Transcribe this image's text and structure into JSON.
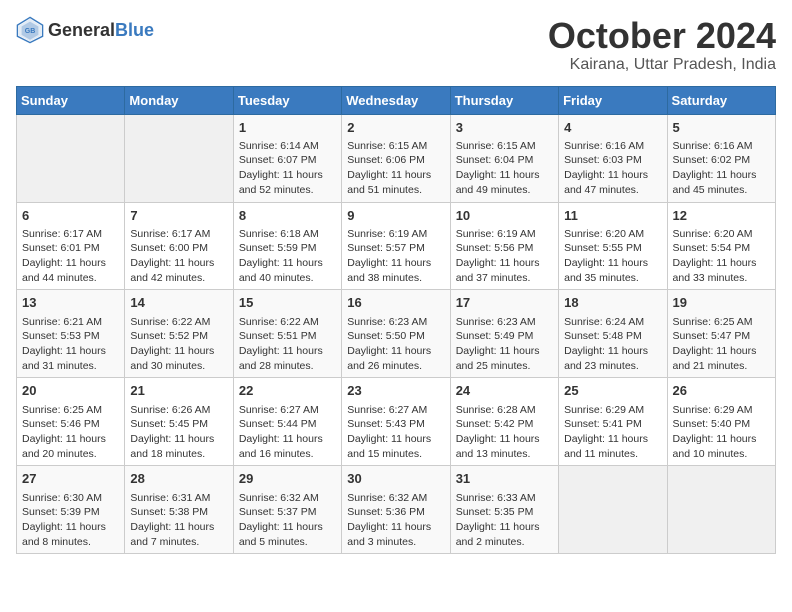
{
  "header": {
    "logo_general": "General",
    "logo_blue": "Blue",
    "title": "October 2024",
    "subtitle": "Kairana, Uttar Pradesh, India"
  },
  "columns": [
    "Sunday",
    "Monday",
    "Tuesday",
    "Wednesday",
    "Thursday",
    "Friday",
    "Saturday"
  ],
  "weeks": [
    [
      {
        "day": "",
        "sunrise": "",
        "sunset": "",
        "daylight": "",
        "empty": true
      },
      {
        "day": "",
        "sunrise": "",
        "sunset": "",
        "daylight": "",
        "empty": true
      },
      {
        "day": "1",
        "sunrise": "Sunrise: 6:14 AM",
        "sunset": "Sunset: 6:07 PM",
        "daylight": "Daylight: 11 hours and 52 minutes.",
        "empty": false
      },
      {
        "day": "2",
        "sunrise": "Sunrise: 6:15 AM",
        "sunset": "Sunset: 6:06 PM",
        "daylight": "Daylight: 11 hours and 51 minutes.",
        "empty": false
      },
      {
        "day": "3",
        "sunrise": "Sunrise: 6:15 AM",
        "sunset": "Sunset: 6:04 PM",
        "daylight": "Daylight: 11 hours and 49 minutes.",
        "empty": false
      },
      {
        "day": "4",
        "sunrise": "Sunrise: 6:16 AM",
        "sunset": "Sunset: 6:03 PM",
        "daylight": "Daylight: 11 hours and 47 minutes.",
        "empty": false
      },
      {
        "day": "5",
        "sunrise": "Sunrise: 6:16 AM",
        "sunset": "Sunset: 6:02 PM",
        "daylight": "Daylight: 11 hours and 45 minutes.",
        "empty": false
      }
    ],
    [
      {
        "day": "6",
        "sunrise": "Sunrise: 6:17 AM",
        "sunset": "Sunset: 6:01 PM",
        "daylight": "Daylight: 11 hours and 44 minutes.",
        "empty": false
      },
      {
        "day": "7",
        "sunrise": "Sunrise: 6:17 AM",
        "sunset": "Sunset: 6:00 PM",
        "daylight": "Daylight: 11 hours and 42 minutes.",
        "empty": false
      },
      {
        "day": "8",
        "sunrise": "Sunrise: 6:18 AM",
        "sunset": "Sunset: 5:59 PM",
        "daylight": "Daylight: 11 hours and 40 minutes.",
        "empty": false
      },
      {
        "day": "9",
        "sunrise": "Sunrise: 6:19 AM",
        "sunset": "Sunset: 5:57 PM",
        "daylight": "Daylight: 11 hours and 38 minutes.",
        "empty": false
      },
      {
        "day": "10",
        "sunrise": "Sunrise: 6:19 AM",
        "sunset": "Sunset: 5:56 PM",
        "daylight": "Daylight: 11 hours and 37 minutes.",
        "empty": false
      },
      {
        "day": "11",
        "sunrise": "Sunrise: 6:20 AM",
        "sunset": "Sunset: 5:55 PM",
        "daylight": "Daylight: 11 hours and 35 minutes.",
        "empty": false
      },
      {
        "day": "12",
        "sunrise": "Sunrise: 6:20 AM",
        "sunset": "Sunset: 5:54 PM",
        "daylight": "Daylight: 11 hours and 33 minutes.",
        "empty": false
      }
    ],
    [
      {
        "day": "13",
        "sunrise": "Sunrise: 6:21 AM",
        "sunset": "Sunset: 5:53 PM",
        "daylight": "Daylight: 11 hours and 31 minutes.",
        "empty": false
      },
      {
        "day": "14",
        "sunrise": "Sunrise: 6:22 AM",
        "sunset": "Sunset: 5:52 PM",
        "daylight": "Daylight: 11 hours and 30 minutes.",
        "empty": false
      },
      {
        "day": "15",
        "sunrise": "Sunrise: 6:22 AM",
        "sunset": "Sunset: 5:51 PM",
        "daylight": "Daylight: 11 hours and 28 minutes.",
        "empty": false
      },
      {
        "day": "16",
        "sunrise": "Sunrise: 6:23 AM",
        "sunset": "Sunset: 5:50 PM",
        "daylight": "Daylight: 11 hours and 26 minutes.",
        "empty": false
      },
      {
        "day": "17",
        "sunrise": "Sunrise: 6:23 AM",
        "sunset": "Sunset: 5:49 PM",
        "daylight": "Daylight: 11 hours and 25 minutes.",
        "empty": false
      },
      {
        "day": "18",
        "sunrise": "Sunrise: 6:24 AM",
        "sunset": "Sunset: 5:48 PM",
        "daylight": "Daylight: 11 hours and 23 minutes.",
        "empty": false
      },
      {
        "day": "19",
        "sunrise": "Sunrise: 6:25 AM",
        "sunset": "Sunset: 5:47 PM",
        "daylight": "Daylight: 11 hours and 21 minutes.",
        "empty": false
      }
    ],
    [
      {
        "day": "20",
        "sunrise": "Sunrise: 6:25 AM",
        "sunset": "Sunset: 5:46 PM",
        "daylight": "Daylight: 11 hours and 20 minutes.",
        "empty": false
      },
      {
        "day": "21",
        "sunrise": "Sunrise: 6:26 AM",
        "sunset": "Sunset: 5:45 PM",
        "daylight": "Daylight: 11 hours and 18 minutes.",
        "empty": false
      },
      {
        "day": "22",
        "sunrise": "Sunrise: 6:27 AM",
        "sunset": "Sunset: 5:44 PM",
        "daylight": "Daylight: 11 hours and 16 minutes.",
        "empty": false
      },
      {
        "day": "23",
        "sunrise": "Sunrise: 6:27 AM",
        "sunset": "Sunset: 5:43 PM",
        "daylight": "Daylight: 11 hours and 15 minutes.",
        "empty": false
      },
      {
        "day": "24",
        "sunrise": "Sunrise: 6:28 AM",
        "sunset": "Sunset: 5:42 PM",
        "daylight": "Daylight: 11 hours and 13 minutes.",
        "empty": false
      },
      {
        "day": "25",
        "sunrise": "Sunrise: 6:29 AM",
        "sunset": "Sunset: 5:41 PM",
        "daylight": "Daylight: 11 hours and 11 minutes.",
        "empty": false
      },
      {
        "day": "26",
        "sunrise": "Sunrise: 6:29 AM",
        "sunset": "Sunset: 5:40 PM",
        "daylight": "Daylight: 11 hours and 10 minutes.",
        "empty": false
      }
    ],
    [
      {
        "day": "27",
        "sunrise": "Sunrise: 6:30 AM",
        "sunset": "Sunset: 5:39 PM",
        "daylight": "Daylight: 11 hours and 8 minutes.",
        "empty": false
      },
      {
        "day": "28",
        "sunrise": "Sunrise: 6:31 AM",
        "sunset": "Sunset: 5:38 PM",
        "daylight": "Daylight: 11 hours and 7 minutes.",
        "empty": false
      },
      {
        "day": "29",
        "sunrise": "Sunrise: 6:32 AM",
        "sunset": "Sunset: 5:37 PM",
        "daylight": "Daylight: 11 hours and 5 minutes.",
        "empty": false
      },
      {
        "day": "30",
        "sunrise": "Sunrise: 6:32 AM",
        "sunset": "Sunset: 5:36 PM",
        "daylight": "Daylight: 11 hours and 3 minutes.",
        "empty": false
      },
      {
        "day": "31",
        "sunrise": "Sunrise: 6:33 AM",
        "sunset": "Sunset: 5:35 PM",
        "daylight": "Daylight: 11 hours and 2 minutes.",
        "empty": false
      },
      {
        "day": "",
        "sunrise": "",
        "sunset": "",
        "daylight": "",
        "empty": true
      },
      {
        "day": "",
        "sunrise": "",
        "sunset": "",
        "daylight": "",
        "empty": true
      }
    ]
  ]
}
